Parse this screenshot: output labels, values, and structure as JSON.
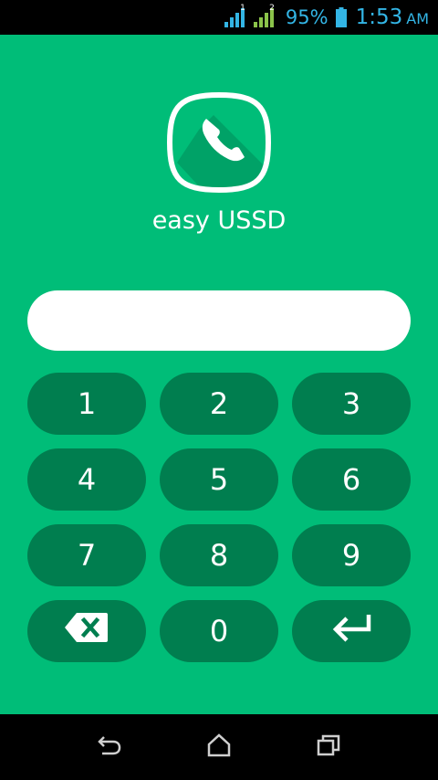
{
  "status_bar": {
    "sim1_label": "1",
    "sim2_label": "2",
    "battery": "95%",
    "time": "1:53",
    "ampm": "AM",
    "accent_color": "#33B5E5",
    "sim2_color": "#8BC34A"
  },
  "app": {
    "name": "easy USSD",
    "background_color": "#00BD78",
    "key_color": "#007E4F"
  },
  "input": {
    "value": "",
    "placeholder": ""
  },
  "keypad": {
    "keys": [
      "1",
      "2",
      "3",
      "4",
      "5",
      "6",
      "7",
      "8",
      "9"
    ],
    "zero": "0",
    "backspace_icon": "backspace-icon",
    "enter_icon": "enter-icon"
  },
  "nav_bar": {
    "back_icon": "back-icon",
    "home_icon": "home-icon",
    "recents_icon": "recents-icon"
  }
}
